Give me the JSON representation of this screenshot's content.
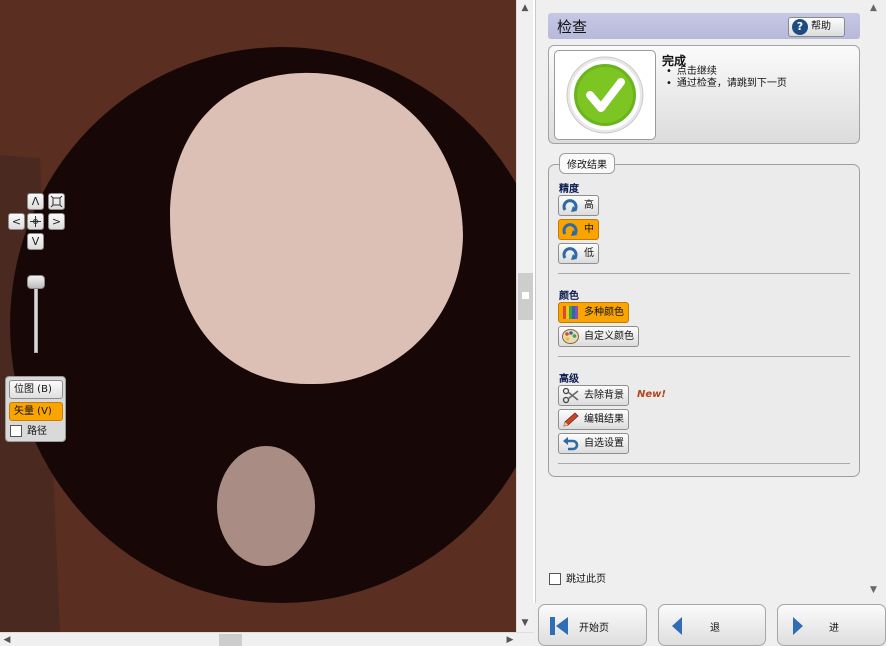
{
  "canvas": {
    "colors": {
      "background": "#5a2f22",
      "dark_oval": "#170807",
      "light_circle": "#dcc0b5",
      "small_oval": "#a98c84"
    }
  },
  "nav_controls": {
    "up": "Λ",
    "down": "V",
    "left": "<",
    "right": ">",
    "fit_icon": "fit-to-screen-icon",
    "center_icon": "center-icon"
  },
  "view_mode": {
    "bitmap_label": "位图 (B)",
    "vector_label": "矢量 (V)",
    "path_label": "路径",
    "selected": "vector"
  },
  "panel": {
    "title": "检查",
    "help_label": "帮助",
    "status": {
      "title": "完成",
      "bullets": [
        "点击继续",
        "通过检查，请跳到下一页"
      ],
      "icon": "checkmark-icon"
    },
    "modify": {
      "legend": "修改结果",
      "precision": {
        "heading": "精度",
        "options": [
          "高",
          "中",
          "低"
        ],
        "selected": "中"
      },
      "color": {
        "heading": "颜色",
        "options": [
          "多种颜色",
          "自定义颜色"
        ],
        "selected": "多种颜色"
      },
      "advanced": {
        "heading": "高级",
        "options": [
          "去除背景",
          "编辑结果",
          "自选设置"
        ],
        "new_badge": "New!"
      }
    },
    "skip_label": "跳过此页"
  },
  "bottom_nav": {
    "start_label": "开始页",
    "back_label": "退",
    "forward_label": "进"
  },
  "colors": {
    "accent_selected": "#f9a400",
    "title_bar": "#c0c1e0",
    "nav_arrow": "#2f6db5"
  }
}
